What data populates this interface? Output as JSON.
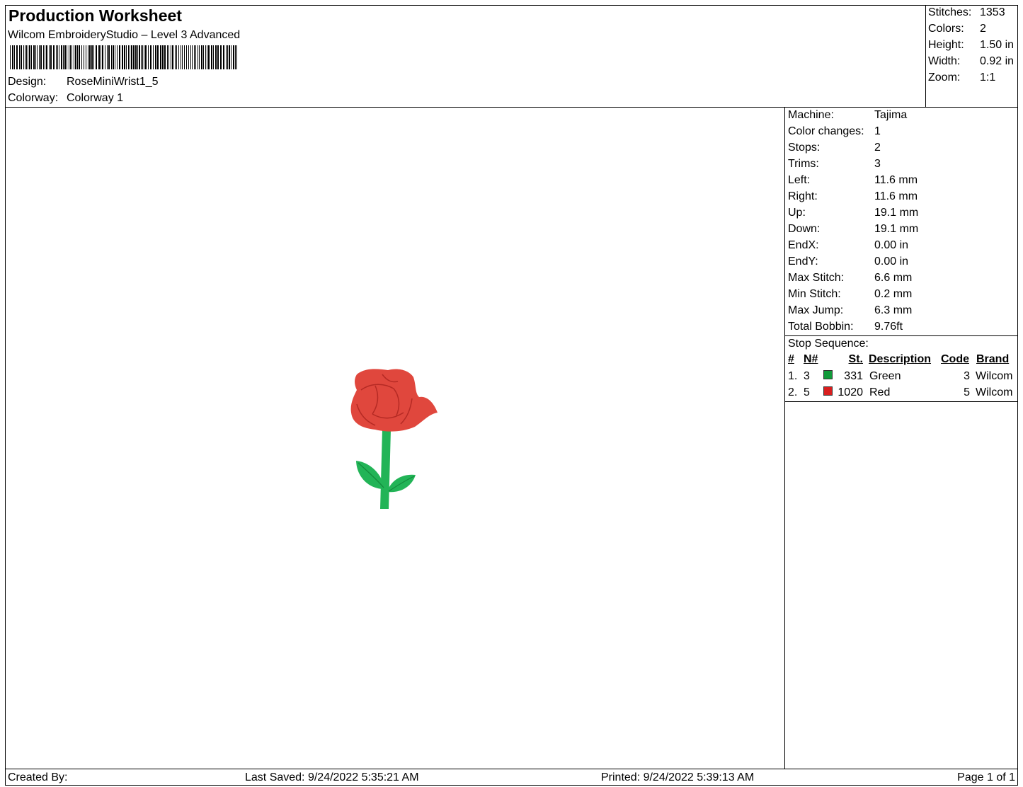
{
  "header": {
    "title": "Production Worksheet",
    "subtitle": "Wilcom EmbroideryStudio – Level 3 Advanced",
    "design_label": "Design:",
    "design_value": "RoseMiniWrist1_5",
    "colorway_label": "Colorway:",
    "colorway_value": "Colorway 1"
  },
  "summary": [
    {
      "label": "Stitches:",
      "value": "1353"
    },
    {
      "label": "Colors:",
      "value": "2"
    },
    {
      "label": "Height:",
      "value": "1.50 in"
    },
    {
      "label": "Width:",
      "value": "0.92 in"
    },
    {
      "label": "Zoom:",
      "value": "1:1"
    }
  ],
  "details": [
    {
      "label": "Machine:",
      "value": "Tajima"
    },
    {
      "label": "Color changes:",
      "value": "1"
    },
    {
      "label": "Stops:",
      "value": "2"
    },
    {
      "label": "Trims:",
      "value": "3"
    },
    {
      "label": "Left:",
      "value": "11.6 mm"
    },
    {
      "label": "Right:",
      "value": "11.6 mm"
    },
    {
      "label": "Up:",
      "value": "19.1 mm"
    },
    {
      "label": "Down:",
      "value": "19.1 mm"
    },
    {
      "label": "EndX:",
      "value": "0.00 in"
    },
    {
      "label": "EndY:",
      "value": "0.00 in"
    },
    {
      "label": "Max Stitch:",
      "value": "6.6 mm"
    },
    {
      "label": "Min Stitch:",
      "value": "0.2 mm"
    },
    {
      "label": "Max Jump:",
      "value": "6.3 mm"
    },
    {
      "label": "Total Bobbin:",
      "value": "9.76ft"
    }
  ],
  "stop_sequence": {
    "title": "Stop Sequence:",
    "columns": {
      "num": "#",
      "n": "N#",
      "st": "St.",
      "description": "Description",
      "code": "Code",
      "brand": "Brand"
    },
    "rows": [
      {
        "num": "1.",
        "n": "3",
        "color": "#119a3a",
        "st": "331",
        "description": "Green",
        "code": "3",
        "brand": "Wilcom"
      },
      {
        "num": "2.",
        "n": "5",
        "color": "#d81e1e",
        "st": "1020",
        "description": "Red",
        "code": "5",
        "brand": "Wilcom"
      }
    ]
  },
  "footer": {
    "created_by": "Created By:",
    "last_saved": "Last Saved: 9/24/2022 5:35:21 AM",
    "printed": "Printed: 9/24/2022 5:39:13 AM",
    "page": "Page 1 of 1"
  },
  "design_colors": {
    "petal": "#e0473d",
    "petal_dark": "#b52a24",
    "stem": "#22b457",
    "stem_dark": "#138a3c"
  }
}
